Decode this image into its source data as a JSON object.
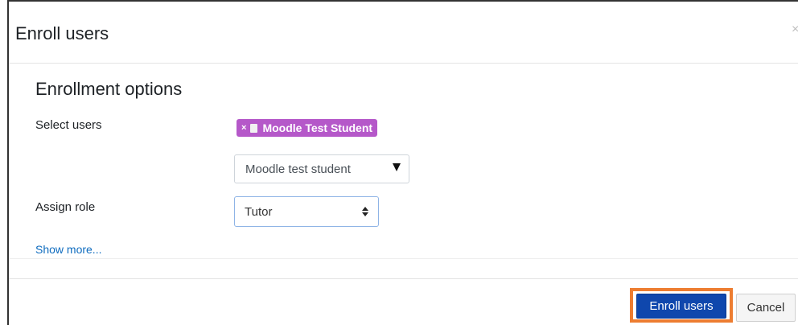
{
  "dialog": {
    "title": "Enroll users",
    "close_glyph": "×"
  },
  "section": {
    "title": "Enrollment options"
  },
  "select_users": {
    "label": "Select users",
    "selected_chip": {
      "remove_glyph": "×",
      "icon": "document-icon",
      "label": "Moodle Test Student",
      "color": "#b558c9"
    },
    "search_value": "Moodle test student",
    "dropdown_icon": "caret-down-icon"
  },
  "assign_role": {
    "label": "Assign role",
    "selected_value": "Tutor",
    "icon": "updown-arrows-icon"
  },
  "show_more": {
    "label": "Show more..."
  },
  "footer": {
    "primary_label": "Enroll users",
    "primary_color": "#0f47ad",
    "highlight_color": "#ed7d31",
    "cancel_label": "Cancel"
  }
}
